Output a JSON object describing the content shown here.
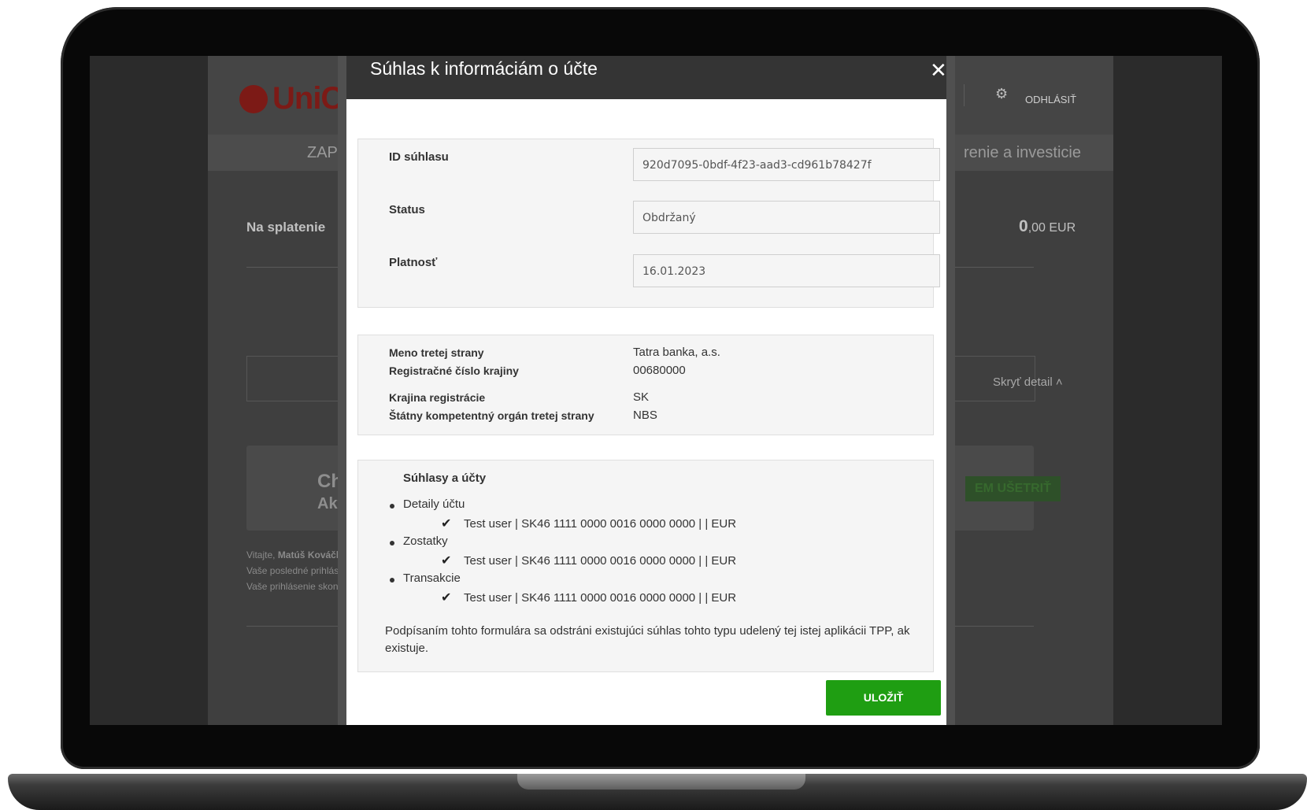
{
  "background_page": {
    "logo": "UniCre",
    "logout": "ODHLÁSIŤ",
    "nav_left": "ZAPLA",
    "nav_right": "renie a investicie",
    "due_label": "Na splatenie",
    "due_value_int": "0",
    "due_value_rest": ",00 EUR",
    "hide_detail": "Skryť detail",
    "promo_title": "Cho",
    "promo_sub": "Akti",
    "promo_button": "EM UŠETRIŤ",
    "welcome_prefix": "Vitajte,",
    "welcome_name": "Matúš Kováčl",
    "last_login": "Vaše posledné prihlás",
    "session_end": "Vaše prihlásenie skon"
  },
  "modal": {
    "title": "Súhlas k informáciám o účte",
    "close_icon": "close-icon",
    "fields": [
      {
        "label": "ID súhlasu",
        "value": "920d7095-0bdf-4f23-aad3-cd961b78427f"
      },
      {
        "label": "Status",
        "value": "Obdržaný"
      },
      {
        "label": "Platnosť",
        "value": "16.01.2023"
      }
    ],
    "third_party": [
      {
        "label": "Meno tretej strany",
        "value": "Tatra banka, a.s."
      },
      {
        "label": "Registračné číslo krajiny",
        "value": "00680000"
      },
      {
        "label": "Krajina registrácie",
        "value": "SK"
      },
      {
        "label": "Štátny kompetentný orgán tretej strany",
        "value": "NBS"
      }
    ],
    "consents_title": "Súhlasy a účty",
    "consents": [
      {
        "type": "Detaily účtu",
        "account": "Test user | SK46 1111 0000 0016 0000 0000 | | EUR",
        "checked": true
      },
      {
        "type": "Zostatky",
        "account": "Test user | SK46 1111 0000 0016 0000 0000 | | EUR",
        "checked": true
      },
      {
        "type": "Transakcie",
        "account": "Test user | SK46 1111 0000 0016 0000 0000 | | EUR",
        "checked": true
      }
    ],
    "note": "Podpísaním tohto formulára sa odstráni existujúci súhlas tohto typu udelený tej istej aplikácii TPP, ak existuje.",
    "save_label": "ULOŽIŤ",
    "save_color": "#1f9e12"
  }
}
